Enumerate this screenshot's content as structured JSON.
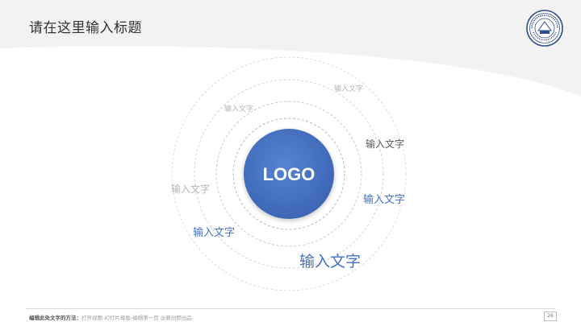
{
  "slide": {
    "title": "请在这里输入标题",
    "logo_text": "LOGO",
    "labels": [
      {
        "id": "label-1",
        "text": "输入文字",
        "color": "#b5b5b5"
      },
      {
        "id": "label-2",
        "text": "输入文字",
        "color": "#b5b5b5"
      },
      {
        "id": "label-3",
        "text": "输入文字",
        "color": "#595959"
      },
      {
        "id": "label-4",
        "text": "输入文字",
        "color": "#4472c4"
      },
      {
        "id": "label-5",
        "text": "输入文字",
        "color": "#b5b5b5"
      },
      {
        "id": "label-6",
        "text": "输入文字",
        "color": "#4472c4"
      },
      {
        "id": "label-7",
        "text": "输入文字",
        "color": "#4472c4"
      }
    ],
    "footer": {
      "label": "编辑此处文字的方法：",
      "text": "打开视图-幻灯片母版-编辑第一页 @原创即出品"
    },
    "page_number": "26",
    "colors": {
      "accent": "#4472c4",
      "ring": "#c8c8c8",
      "logo_fill": "#4472c4"
    }
  }
}
